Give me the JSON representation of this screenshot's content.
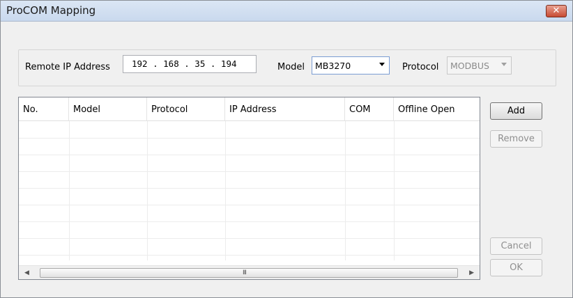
{
  "window": {
    "title": "ProCOM Mapping",
    "close_glyph": "✕"
  },
  "settings": {
    "remote_ip_label": "Remote IP Address",
    "ip_address": "192 . 168 . 35 . 194",
    "model_label": "Model",
    "model_value": "MB3270",
    "protocol_label": "Protocol",
    "protocol_value": "MODBUS"
  },
  "table": {
    "columns": [
      "No.",
      "Model",
      "Protocol",
      "IP Address",
      "COM",
      "Offline Open"
    ],
    "rows": []
  },
  "scrollbar": {
    "left_arrow": "◀",
    "right_arrow": "▶",
    "grip": "III"
  },
  "buttons": {
    "add": "Add",
    "remove": "Remove",
    "cancel": "Cancel",
    "ok": "OK"
  }
}
